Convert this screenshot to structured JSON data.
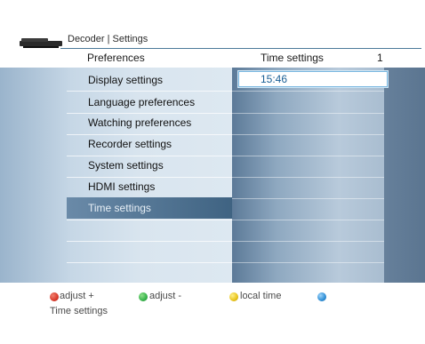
{
  "header": {
    "breadcrumb": "Decoder | Settings",
    "preferences_title": "Preferences",
    "time_settings_title": "Time settings",
    "page_number": "1"
  },
  "menu": {
    "items": [
      {
        "label": "Display settings"
      },
      {
        "label": "Language preferences"
      },
      {
        "label": "Watching preferences"
      },
      {
        "label": "Recorder settings"
      },
      {
        "label": "System settings"
      },
      {
        "label": "HDMI settings"
      },
      {
        "label": "Time settings",
        "selected": true
      }
    ]
  },
  "time_field": {
    "value": "15:46"
  },
  "legend": {
    "red": {
      "label": "adjust +",
      "color": "#d93a2b"
    },
    "green": {
      "label": "adjust -",
      "color": "#36b34a"
    },
    "yellow": {
      "label": "local time",
      "color": "#e8c31a"
    },
    "blue": {
      "label": "",
      "color": "#2f8fd6"
    }
  },
  "footer": {
    "label": "Time settings"
  },
  "icons": {
    "decoder": "set-top-box-icon"
  }
}
